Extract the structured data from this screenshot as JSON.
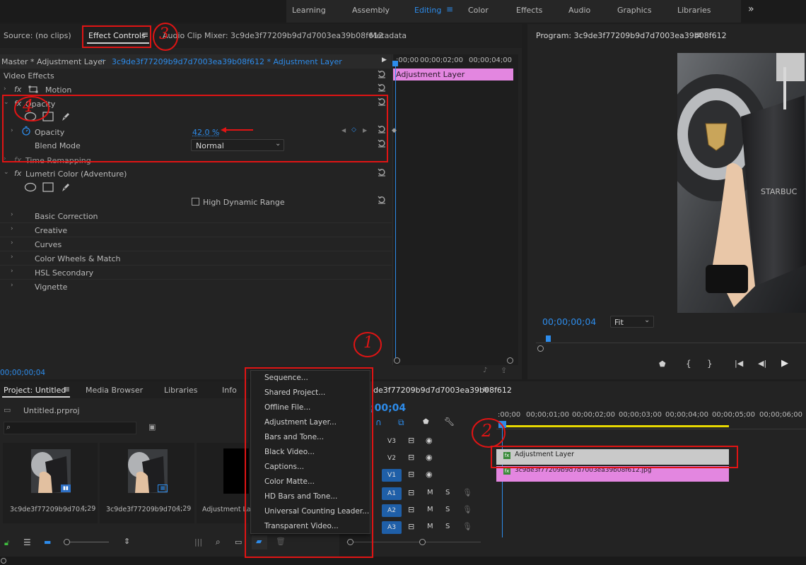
{
  "workspaces": {
    "items": [
      "Learning",
      "Assembly",
      "Editing",
      "Color",
      "Effects",
      "Audio",
      "Graphics",
      "Libraries"
    ],
    "more": "»"
  },
  "source_panel": {
    "tabs": [
      "Source: (no clips)",
      "Effect Controls",
      "Audio Clip Mixer: 3c9de3f77209b9d7d7003ea39b08f612",
      "Metadata"
    ]
  },
  "effect_controls": {
    "master_label": "Master * Adjustment Layer",
    "clip_label": "3c9de3f77209b9d7d7003ea39b08f612 * Adjustment Layer",
    "section_title": "Video Effects",
    "motion": "Motion",
    "opacity_group": "Opacity",
    "opacity_param": "Opacity",
    "opacity_value": "42.0 %",
    "blend_mode_label": "Blend Mode",
    "blend_mode_value": "Normal",
    "time_remapping": "Time Remapping",
    "lumetri": "Lumetri Color (Adventure)",
    "hdr": "High Dynamic Range",
    "lumetri_items": [
      "Basic Correction",
      "Creative",
      "Curves",
      "Color Wheels & Match",
      "HSL Secondary",
      "Vignette"
    ],
    "timecode": "00;00;00;04",
    "mini_ruler": [
      ";00;00",
      "00;00;02;00",
      "00;00;04;00"
    ],
    "clip_bar": "Adjustment Layer"
  },
  "program": {
    "title": "Program: 3c9de3f77209b9d7d7003ea39b08f612",
    "timecode": "00;00;00;04",
    "fit": "Fit"
  },
  "project": {
    "tabs": [
      "Project: Untitled",
      "Media Browser",
      "Libraries",
      "Info"
    ],
    "file": "Untitled.prproj",
    "items": [
      {
        "name": "3c9de3f77209b9d70...",
        "duration": "4;29"
      },
      {
        "name": "3c9de3f77209b9d70...",
        "duration": "4;29"
      },
      {
        "name": "Adjustment Layer",
        "duration": ""
      }
    ]
  },
  "new_item_menu": {
    "items": [
      "Sequence...",
      "Shared Project...",
      "Offline File...",
      "Adjustment Layer...",
      "Bars and Tone...",
      "Black Video...",
      "Captions...",
      "Color Matte...",
      "HD Bars and Tone...",
      "Universal Counting Leader...",
      "Transparent Video..."
    ]
  },
  "timeline": {
    "title": "de3f77209b9d7d7003ea39b08f612",
    "timecode": ";00;04",
    "ruler": [
      ":00;00",
      "00;00;01;00",
      "00;00;02;00",
      "00;00;03;00",
      "00;00;04;00",
      "00;00;05;00",
      "00;00;06;00"
    ],
    "video_tracks": [
      "V3",
      "V2",
      "V1"
    ],
    "audio_tracks": [
      "A1",
      "A2",
      "A3"
    ],
    "clips": {
      "adjustment": "Adjustment Layer",
      "image": "3c9de3f77209b9d7d7003ea39b08f612.jpg"
    }
  },
  "annotations": [
    "1",
    "2",
    "3",
    "4"
  ],
  "colors": {
    "accent": "#2d8ceb",
    "clip_pink": "#e386e0",
    "annotation_red": "#e01414",
    "panel": "#232323"
  }
}
